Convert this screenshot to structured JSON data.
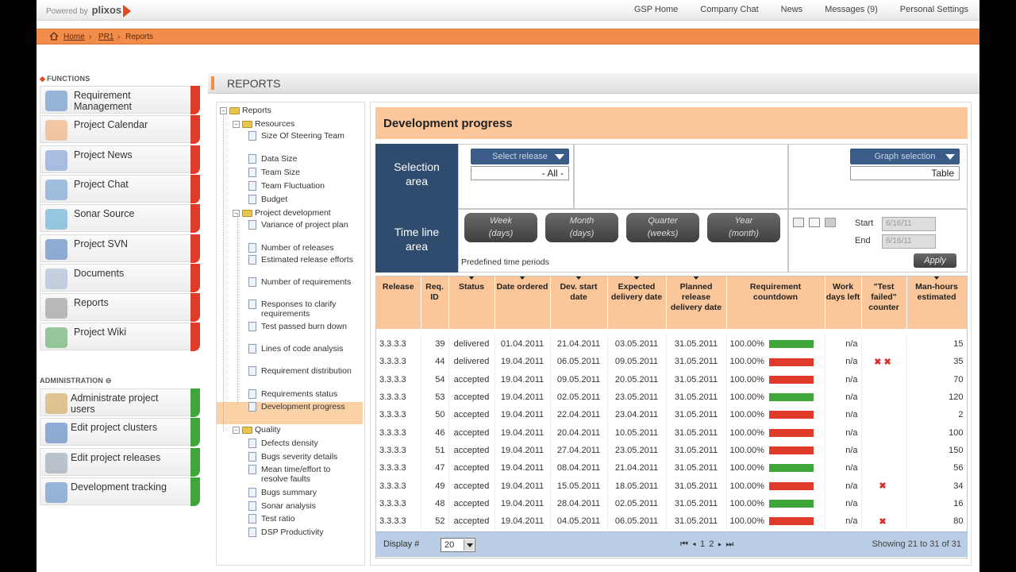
{
  "brand": {
    "powered_by": "Powered by",
    "logo": "plixos"
  },
  "topnav": [
    "GSP Home",
    "Company Chat",
    "News",
    "Messages (9)",
    "Personal Settings"
  ],
  "breadcrumb": {
    "home": "Home",
    "project": "PR1",
    "current": "Reports"
  },
  "sidebar": {
    "functions_title": "FUNCTIONS",
    "functions": [
      {
        "label": "Requirement Management",
        "icon": "people-icon"
      },
      {
        "label": "Project Calendar",
        "icon": "calendar-icon"
      },
      {
        "label": "Project News",
        "icon": "news-icon"
      },
      {
        "label": "Project Chat",
        "icon": "chat-icon"
      },
      {
        "label": "Sonar Source",
        "icon": "sonar-icon"
      },
      {
        "label": "Project SVN",
        "icon": "svn-icon"
      },
      {
        "label": "Documents",
        "icon": "documents-icon"
      },
      {
        "label": "Reports",
        "icon": "reports-icon"
      },
      {
        "label": "Project Wiki",
        "icon": "wiki-icon"
      }
    ],
    "admin_title": "ADMINISTRATION",
    "admin": [
      {
        "label": "Administrate project users",
        "icon": "users-icon"
      },
      {
        "label": "Edit project clusters",
        "icon": "clusters-icon"
      },
      {
        "label": "Edit project releases",
        "icon": "releases-icon"
      },
      {
        "label": "Development tracking",
        "icon": "tracking-icon"
      }
    ]
  },
  "reports_title": "REPORTS",
  "tree": {
    "root": "Reports",
    "resources": "Resources",
    "resources_items": [
      "Size Of Steering Team",
      "Data Size",
      "Team Size",
      "Team Fluctuation",
      "Budget"
    ],
    "projdev": "Project development",
    "projdev_items": [
      "Variance of project plan",
      "Number of releases",
      "Estimated release efforts",
      "Number of requirements",
      "Responses to clarify requirements",
      "Test passed burn down",
      "Lines of code analysis",
      "Requirement distribution",
      "Requirements status",
      "Development progress"
    ],
    "quality": "Quality",
    "quality_items": [
      "Defects density",
      "Bugs severity details",
      "Mean time/effort to resolve faults",
      "Bugs summary",
      "Sonar analysis",
      "Test ratio",
      "DSP Productivity"
    ]
  },
  "panel": {
    "title": "Development progress",
    "selection_area": "Selection area",
    "select_release": "Select release",
    "release_value": "- All -",
    "graph_selection": "Graph selection",
    "graph_value": "Table",
    "timeline_area": "Time line area",
    "time_buttons": [
      {
        "top": "Week",
        "bottom": "(days)"
      },
      {
        "top": "Month",
        "bottom": "(days)"
      },
      {
        "top": "Quarter",
        "bottom": "(weeks)"
      },
      {
        "top": "Year",
        "bottom": "(month)"
      }
    ],
    "predefined": "Predefined time periods",
    "start_label": "Start",
    "end_label": "End",
    "start_date": "6/16/11",
    "end_date": "6/16/11",
    "apply": "Apply"
  },
  "table": {
    "headers": [
      "Release",
      "Req. ID",
      "Status",
      "Date ordered",
      "Dev. start date",
      "Expected delivery date",
      "Planned release delivery date",
      "Requirement countdown",
      "Work days left",
      "\"Test failed\" counter",
      "Man-hours estimated"
    ],
    "rows": [
      {
        "release": "3.3.3.3",
        "id": "39",
        "status": "delivered",
        "ordered": "01.04.2011",
        "devstart": "21.04.2011",
        "expected": "03.05.2011",
        "planned": "31.05.2011",
        "pct": "100.00%",
        "bar": "green",
        "days": "n/a",
        "failed": 0,
        "hours": "15"
      },
      {
        "release": "3.3.3.3",
        "id": "44",
        "status": "delivered",
        "ordered": "19.04.2011",
        "devstart": "06.05.2011",
        "expected": "09.05.2011",
        "planned": "31.05.2011",
        "pct": "100.00%",
        "bar": "red",
        "days": "n/a",
        "failed": 2,
        "hours": "35"
      },
      {
        "release": "3.3.3.3",
        "id": "54",
        "status": "accepted",
        "ordered": "19.04.2011",
        "devstart": "09.05.2011",
        "expected": "20.05.2011",
        "planned": "31.05.2011",
        "pct": "100.00%",
        "bar": "red",
        "days": "n/a",
        "failed": 0,
        "hours": "70"
      },
      {
        "release": "3.3.3.3",
        "id": "53",
        "status": "accepted",
        "ordered": "19.04.2011",
        "devstart": "02.05.2011",
        "expected": "23.05.2011",
        "planned": "31.05.2011",
        "pct": "100.00%",
        "bar": "green",
        "days": "n/a",
        "failed": 0,
        "hours": "120"
      },
      {
        "release": "3.3.3.3",
        "id": "50",
        "status": "accepted",
        "ordered": "19.04.2011",
        "devstart": "22.04.2011",
        "expected": "23.04.2011",
        "planned": "31.05.2011",
        "pct": "100.00%",
        "bar": "red",
        "days": "n/a",
        "failed": 0,
        "hours": "2"
      },
      {
        "release": "3.3.3.3",
        "id": "46",
        "status": "accepted",
        "ordered": "19.04.2011",
        "devstart": "20.04.2011",
        "expected": "10.05.2011",
        "planned": "31.05.2011",
        "pct": "100.00%",
        "bar": "red",
        "days": "n/a",
        "failed": 0,
        "hours": "100"
      },
      {
        "release": "3.3.3.3",
        "id": "51",
        "status": "accepted",
        "ordered": "19.04.2011",
        "devstart": "27.04.2011",
        "expected": "23.05.2011",
        "planned": "31.05.2011",
        "pct": "100.00%",
        "bar": "red",
        "days": "n/a",
        "failed": 0,
        "hours": "150"
      },
      {
        "release": "3.3.3.3",
        "id": "47",
        "status": "accepted",
        "ordered": "19.04.2011",
        "devstart": "08.04.2011",
        "expected": "21.04.2011",
        "planned": "31.05.2011",
        "pct": "100.00%",
        "bar": "green",
        "days": "n/a",
        "failed": 0,
        "hours": "56"
      },
      {
        "release": "3.3.3.3",
        "id": "49",
        "status": "accepted",
        "ordered": "19.04.2011",
        "devstart": "15.05.2011",
        "expected": "18.05.2011",
        "planned": "31.05.2011",
        "pct": "100.00%",
        "bar": "red",
        "days": "n/a",
        "failed": 1,
        "hours": "34"
      },
      {
        "release": "3.3.3.3",
        "id": "48",
        "status": "accepted",
        "ordered": "19.04.2011",
        "devstart": "28.04.2011",
        "expected": "02.05.2011",
        "planned": "31.05.2011",
        "pct": "100.00%",
        "bar": "green",
        "days": "n/a",
        "failed": 0,
        "hours": "16"
      },
      {
        "release": "3.3.3.3",
        "id": "52",
        "status": "accepted",
        "ordered": "19.04.2011",
        "devstart": "04.05.2011",
        "expected": "06.05.2011",
        "planned": "31.05.2011",
        "pct": "100.00%",
        "bar": "red",
        "days": "n/a",
        "failed": 1,
        "hours": "80"
      }
    ]
  },
  "footer": {
    "display_label": "Display #",
    "display_value": "20",
    "pages": "1 2",
    "showing": "Showing 21 to 31 of 31"
  },
  "colors": {
    "orange": "#f28c4a",
    "peach": "#fbc79a",
    "navy": "#2f4b6e",
    "bar_green": "#3fa63a",
    "bar_red": "#e03a2a"
  }
}
